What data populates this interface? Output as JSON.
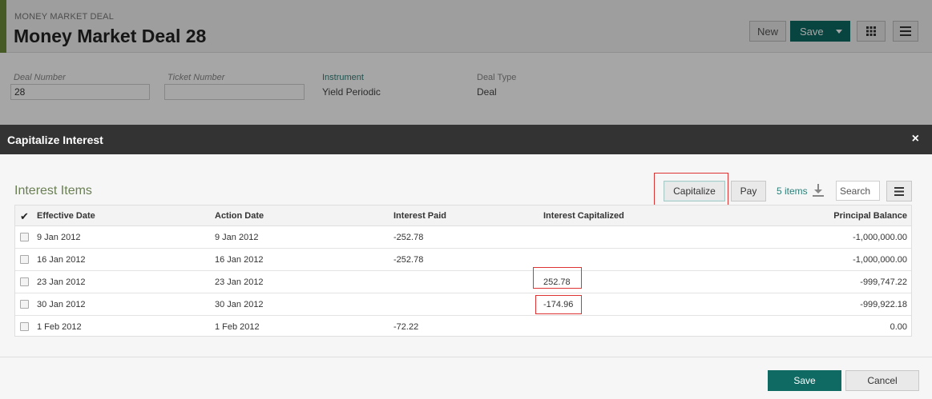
{
  "deal": {
    "subtitle": "MONEY MARKET DEAL",
    "title": "Money Market Deal 28",
    "buttons": {
      "new": "New",
      "save": "Save"
    },
    "fields": [
      {
        "label": "Deal Number",
        "value": "28"
      },
      {
        "label": "Ticket Number",
        "value": ""
      },
      {
        "label": "Instrument",
        "value": "Yield Periodic"
      },
      {
        "label": "Deal Type",
        "value": "Deal"
      }
    ]
  },
  "modal": {
    "title": "Capitalize Interest",
    "close_icon": "×",
    "section_title": "Interest Items",
    "toolbar": {
      "capitalize": "Capitalize",
      "pay": "Pay",
      "items_count": "5 items",
      "search_placeholder": "Search"
    },
    "columns": [
      "Effective Date",
      "Action Date",
      "Interest Paid",
      "Interest Capitalized",
      "Principal Balance"
    ],
    "rows": [
      {
        "effective": "9 Jan 2012",
        "action": "9 Jan 2012",
        "paid": "-252.78",
        "capitalized": "",
        "balance": "-1,000,000.00"
      },
      {
        "effective": "16 Jan 2012",
        "action": "16 Jan 2012",
        "paid": "-252.78",
        "capitalized": "",
        "balance": "-1,000,000.00"
      },
      {
        "effective": "23 Jan 2012",
        "action": "23 Jan 2012",
        "paid": "",
        "capitalized": "252.78",
        "balance": "-999,747.22"
      },
      {
        "effective": "30 Jan 2012",
        "action": "30 Jan 2012",
        "paid": "",
        "capitalized": "-174.96",
        "balance": "-999,922.18"
      },
      {
        "effective": "1 Feb 2012",
        "action": "1 Feb 2012",
        "paid": "-72.22",
        "capitalized": "",
        "balance": "0.00"
      }
    ],
    "footer": {
      "save": "Save",
      "cancel": "Cancel"
    }
  },
  "colors": {
    "brand": "#0f6a63",
    "accent_bar": "#6c8a3b",
    "highlight": "#dd3333",
    "modal_header": "#333333"
  }
}
